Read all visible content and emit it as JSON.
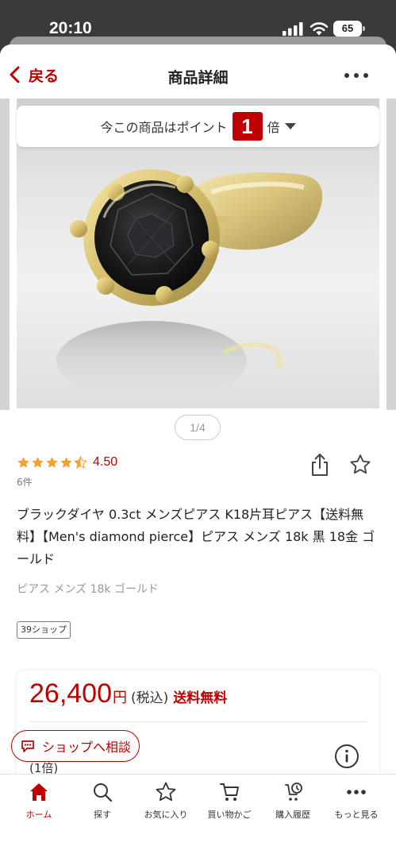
{
  "status_bar": {
    "time": "20:10",
    "battery": "65"
  },
  "nav": {
    "back_label": "戻る",
    "title": "商品詳細"
  },
  "points_banner": {
    "prefix": "今この商品はポイント",
    "multiplier": "1",
    "suffix": "倍"
  },
  "gallery": {
    "pager": "1/4"
  },
  "rating": {
    "value": "4.50",
    "stars": 4.5,
    "review_count": "6件"
  },
  "product": {
    "title": "ブラックダイヤ 0.3ct メンズピアス K18片耳ピアス【送料無料】【Men's diamond pierce】ピアス メンズ 18k 黒 18金 ゴールド",
    "subtitle": "ピアス メンズ 18k ゴールド",
    "shop_tag": "39ショップ"
  },
  "price": {
    "amount": "26,400",
    "unit": "円",
    "tax_note": "(税込)",
    "shipping": "送料無料",
    "points_multiplier": "(1倍)"
  },
  "consult_button": {
    "label": "ショップへ相談"
  },
  "tabbar": {
    "items": [
      {
        "label": "ホーム",
        "icon": "home-icon"
      },
      {
        "label": "探す",
        "icon": "search-icon"
      },
      {
        "label": "お気に入り",
        "icon": "star-icon"
      },
      {
        "label": "買い物かご",
        "icon": "cart-icon"
      },
      {
        "label": "購入履歴",
        "icon": "history-icon"
      },
      {
        "label": "もっと見る",
        "icon": "more-icon"
      }
    ]
  },
  "colors": {
    "accent": "#bf0000",
    "star": "#f2a134",
    "text": "#222222"
  }
}
